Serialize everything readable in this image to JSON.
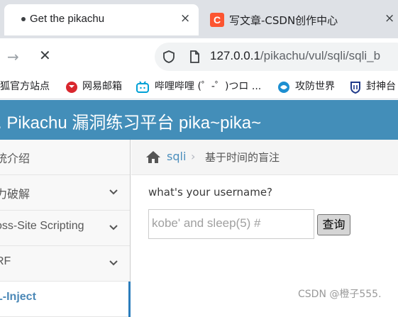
{
  "browser": {
    "tabs": [
      {
        "title": "Get the pikachu",
        "active": true,
        "close": "×"
      },
      {
        "title": "写文章-CSDN创作中心",
        "favicon": "C",
        "favicon_color": "#fc5531",
        "close": "×"
      }
    ],
    "toolbar": {
      "forward_icon": "→",
      "stop_icon": "✕",
      "url_host": "127.0.0.1",
      "url_path": "/pikachu/vul/sqli/sqli_b"
    },
    "bookmarks": [
      {
        "label": "狐官方站点",
        "icon": "firefox-icon"
      },
      {
        "label": "网易邮箱",
        "icon": "netease-mail-icon"
      },
      {
        "label": "哔哩哔哩 (゜-゜)つロ ...",
        "icon": "bilibili-icon"
      },
      {
        "label": "攻防世界",
        "icon": "adworld-icon"
      },
      {
        "label": "封神台",
        "icon": "fengshentai-icon"
      }
    ]
  },
  "page": {
    "header_title": "Pikachu 漏洞练习平台 pika~pika~",
    "header_prefix": ".",
    "header_color": "#438eb9",
    "sidebar": {
      "items": [
        {
          "label": "统介绍",
          "chevron": false
        },
        {
          "label": "力破解",
          "chevron": true
        },
        {
          "label": "oss-Site Scripting",
          "chevron": true
        },
        {
          "label": "RF",
          "chevron": true
        },
        {
          "label": "L-Inject",
          "chevron": false,
          "active": true
        }
      ]
    },
    "breadcrumbs": {
      "home_icon": "home-icon",
      "crumb1": "sqli",
      "separator": "›",
      "crumb2": "基于时间的盲注"
    },
    "form": {
      "prompt": "what's your username?",
      "input_value": "kobe' and sleep(5) #",
      "submit_label": "查询"
    },
    "watermark": "CSDN @橙子555."
  }
}
